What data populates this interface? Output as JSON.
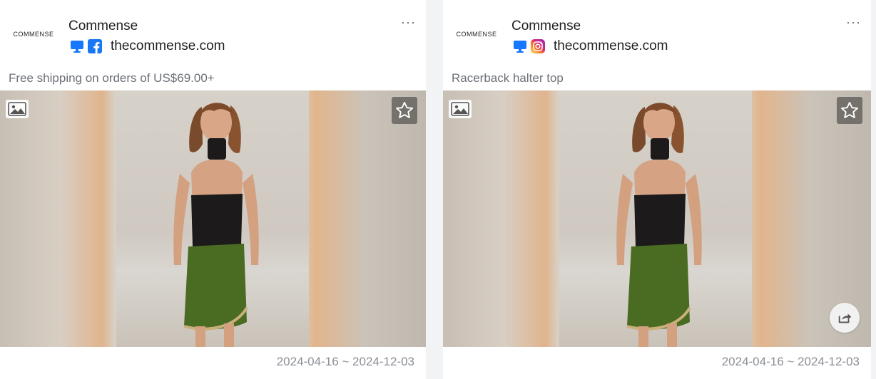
{
  "cards": [
    {
      "brand_logo_text": "COMMENSE",
      "brand_name": "Commense",
      "platform_icons": [
        "desktop-icon",
        "facebook-icon"
      ],
      "domain": "thecommense.com",
      "more_label": "···",
      "ad_text": "Free shipping on orders of US$69.00+",
      "date_range": "2024-04-16 ~ 2024-12-03",
      "has_share": false
    },
    {
      "brand_logo_text": "COMMENSE",
      "brand_name": "Commense",
      "platform_icons": [
        "desktop-icon",
        "instagram-icon"
      ],
      "domain": "thecommense.com",
      "more_label": "···",
      "ad_text": "Racerback halter top",
      "date_range": "2024-04-16 ~ 2024-12-03",
      "has_share": true
    }
  ],
  "colors": {
    "desktop": "#1677ff",
    "facebook": "#1877f2",
    "skirt": "#4a6b22",
    "top": "#1c1a1a"
  }
}
